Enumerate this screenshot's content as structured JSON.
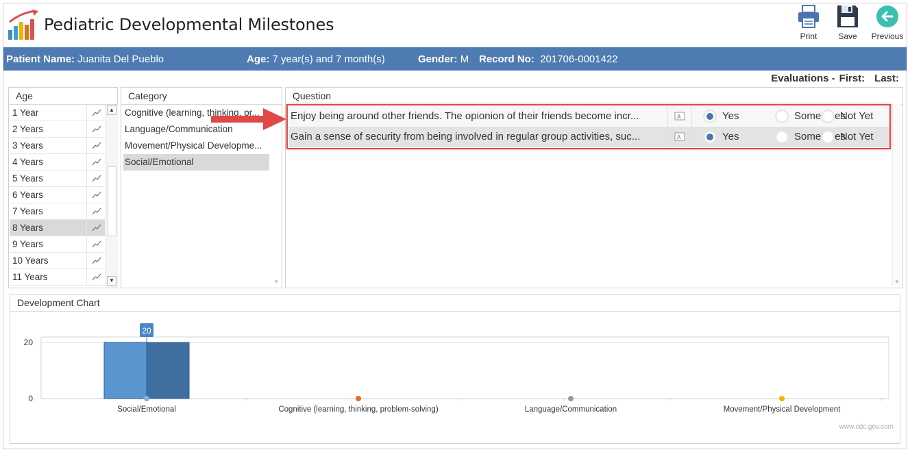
{
  "app": {
    "title": "Pediatric Developmental Milestones"
  },
  "toolbar": {
    "print_label": "Print",
    "save_label": "Save",
    "previous_label": "Previous"
  },
  "patient": {
    "name_label": "Patient Name:",
    "name": "Juanita Del Pueblo",
    "age_label": "Age:",
    "age": "7 year(s) and 7 month(s)",
    "gender_label": "Gender:",
    "gender": "M",
    "record_label": "Record No:",
    "record": "201706-0001422"
  },
  "evaluations": {
    "label": "Evaluations -",
    "first_label": "First:",
    "last_label": "Last:"
  },
  "age_panel": {
    "header": "Age",
    "items": [
      "1 Year",
      "2 Years",
      "3 Years",
      "4 Years",
      "5 Years",
      "6 Years",
      "7 Years",
      "8 Years",
      "9 Years",
      "10 Years",
      "11 Years"
    ],
    "selected": "8 Years"
  },
  "category_panel": {
    "header": "Category",
    "items": [
      "Cognitive (learning, thinking, pr...",
      "Language/Communication",
      "Movement/Physical Developme...",
      "Social/Emotional"
    ],
    "selected": "Social/Emotional"
  },
  "question_panel": {
    "header": "Question",
    "options": [
      "Yes",
      "Sometimes",
      "Not Yet"
    ],
    "questions": [
      {
        "text": "Enjoy being around other friends. The opionion of their friends become incr...",
        "answer": "Yes"
      },
      {
        "text": "Gain a sense of security from being involved in regular group activities, suc...",
        "answer": "Yes"
      }
    ]
  },
  "chart_panel": {
    "header": "Development Chart",
    "watermark": "www.cdc.gov.com"
  },
  "chart_data": {
    "type": "bar",
    "categories": [
      "Social/Emotional",
      "Cognitive (learning, thinking, problem-solving)",
      "Language/Communication",
      "Movement/Physical Development"
    ],
    "values": [
      20,
      0,
      0,
      0
    ],
    "data_labels": [
      "20"
    ],
    "yticks": [
      0,
      20
    ],
    "ylim": [
      0,
      20
    ],
    "colors": {
      "bar": "#4a86c5",
      "point_cognitive": "#e0701e",
      "point_language": "#9a9a9a",
      "point_movement": "#f0b400"
    }
  },
  "colors": {
    "accent": "#4f7bb3",
    "highlight": "#e04848"
  }
}
